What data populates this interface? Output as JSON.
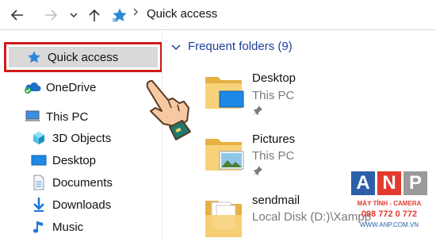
{
  "address_bar": {
    "location": "Quick access",
    "icons": [
      "back-arrow-icon",
      "forward-arrow-icon",
      "recent-locations-chevron-icon",
      "up-arrow-icon",
      "quick-access-star-icon",
      "breadcrumb-chevron-icon"
    ]
  },
  "nav_pane": {
    "items": [
      {
        "label": "Quick access",
        "icon": "star",
        "selected": true
      },
      {
        "label": "OneDrive",
        "icon": "cloud"
      },
      {
        "label": "This PC",
        "icon": "computer"
      },
      {
        "label": "3D Objects",
        "icon": "cube"
      },
      {
        "label": "Desktop",
        "icon": "desktop"
      },
      {
        "label": "Documents",
        "icon": "document"
      },
      {
        "label": "Downloads",
        "icon": "download"
      },
      {
        "label": "Music",
        "icon": "music"
      }
    ]
  },
  "content": {
    "group_title": "Frequent folders (9)",
    "folders": [
      {
        "name": "Desktop",
        "location": "This PC",
        "pinned": true
      },
      {
        "name": "Pictures",
        "location": "This PC",
        "pinned": true
      },
      {
        "name": "sendmail",
        "location": "Local Disk (D:)\\Xampp"
      }
    ]
  },
  "watermark": {
    "letters": [
      "A",
      "N",
      "P"
    ],
    "line1": "MÁY TÍNH - CAMERA",
    "line2": "098 772 0 772",
    "line3": "WWW.ANP.COM.VN"
  },
  "colors": {
    "highlight_border": "#d21a1a",
    "selected_bg": "#d9d9d9",
    "group_title": "#1f3e99",
    "star": "#2b88d8",
    "folder": "#f2c55c",
    "wm_a": "#2c5fa8",
    "wm_n": "#e23a2e",
    "wm_p": "#9a9a9a"
  }
}
